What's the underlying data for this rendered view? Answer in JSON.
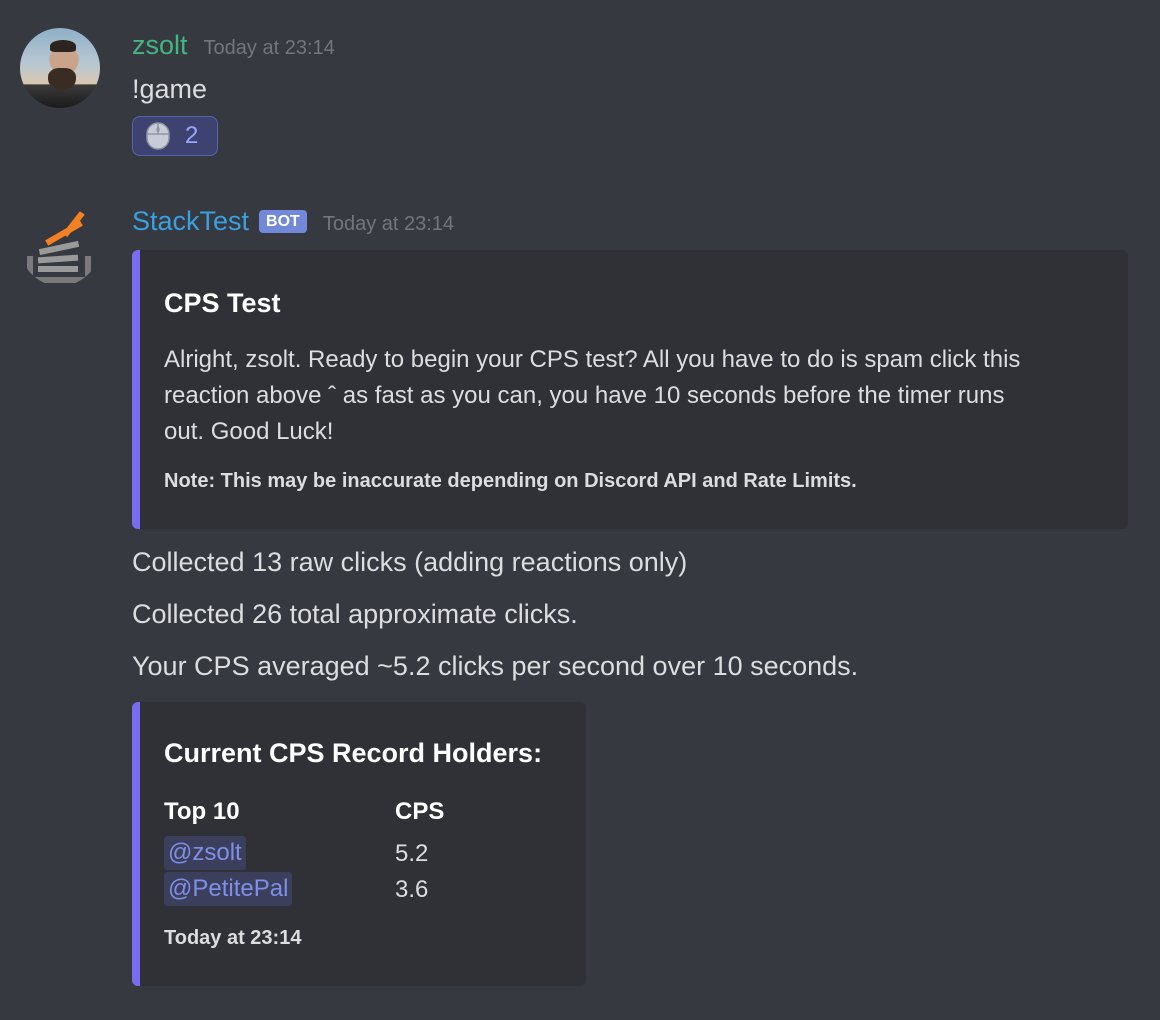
{
  "messages": [
    {
      "author": "zsolt",
      "timestamp": "Today at 23:14",
      "content": "!game",
      "reaction": {
        "icon": "mouse-icon",
        "count": "2"
      }
    },
    {
      "author": "StackTest",
      "badge": "BOT",
      "timestamp": "Today at 23:14",
      "embed": {
        "title": "CPS Test",
        "description_lines": [
          "Alright, zsolt. Ready to begin your CPS test? All you have to do is spam click this",
          "reaction above ˆ as fast as you can, you have 10 seconds before the timer runs",
          "out. Good Luck!"
        ],
        "note": "Note: This may be inaccurate depending on Discord API and Rate Limits."
      },
      "lines": [
        "Collected 13 raw clicks (adding reactions only)",
        "Collected 26 total approximate clicks.",
        "Your CPS averaged ~5.2 clicks per second over 10 seconds."
      ],
      "record_embed": {
        "title": "Current CPS Record Holders:",
        "col1_header": "Top 10",
        "col2_header": "CPS",
        "rows": [
          {
            "user": "@zsolt",
            "cps": "5.2"
          },
          {
            "user": "@PetitePal",
            "cps": "3.6"
          }
        ],
        "footer": "Today at 23:14"
      }
    }
  ],
  "colors": {
    "background": "#36393f",
    "embed_bg": "#2f3136",
    "embed_accent": "#7a6cf0",
    "user_color": "#43b581",
    "bot_color": "#3aa0e0"
  }
}
